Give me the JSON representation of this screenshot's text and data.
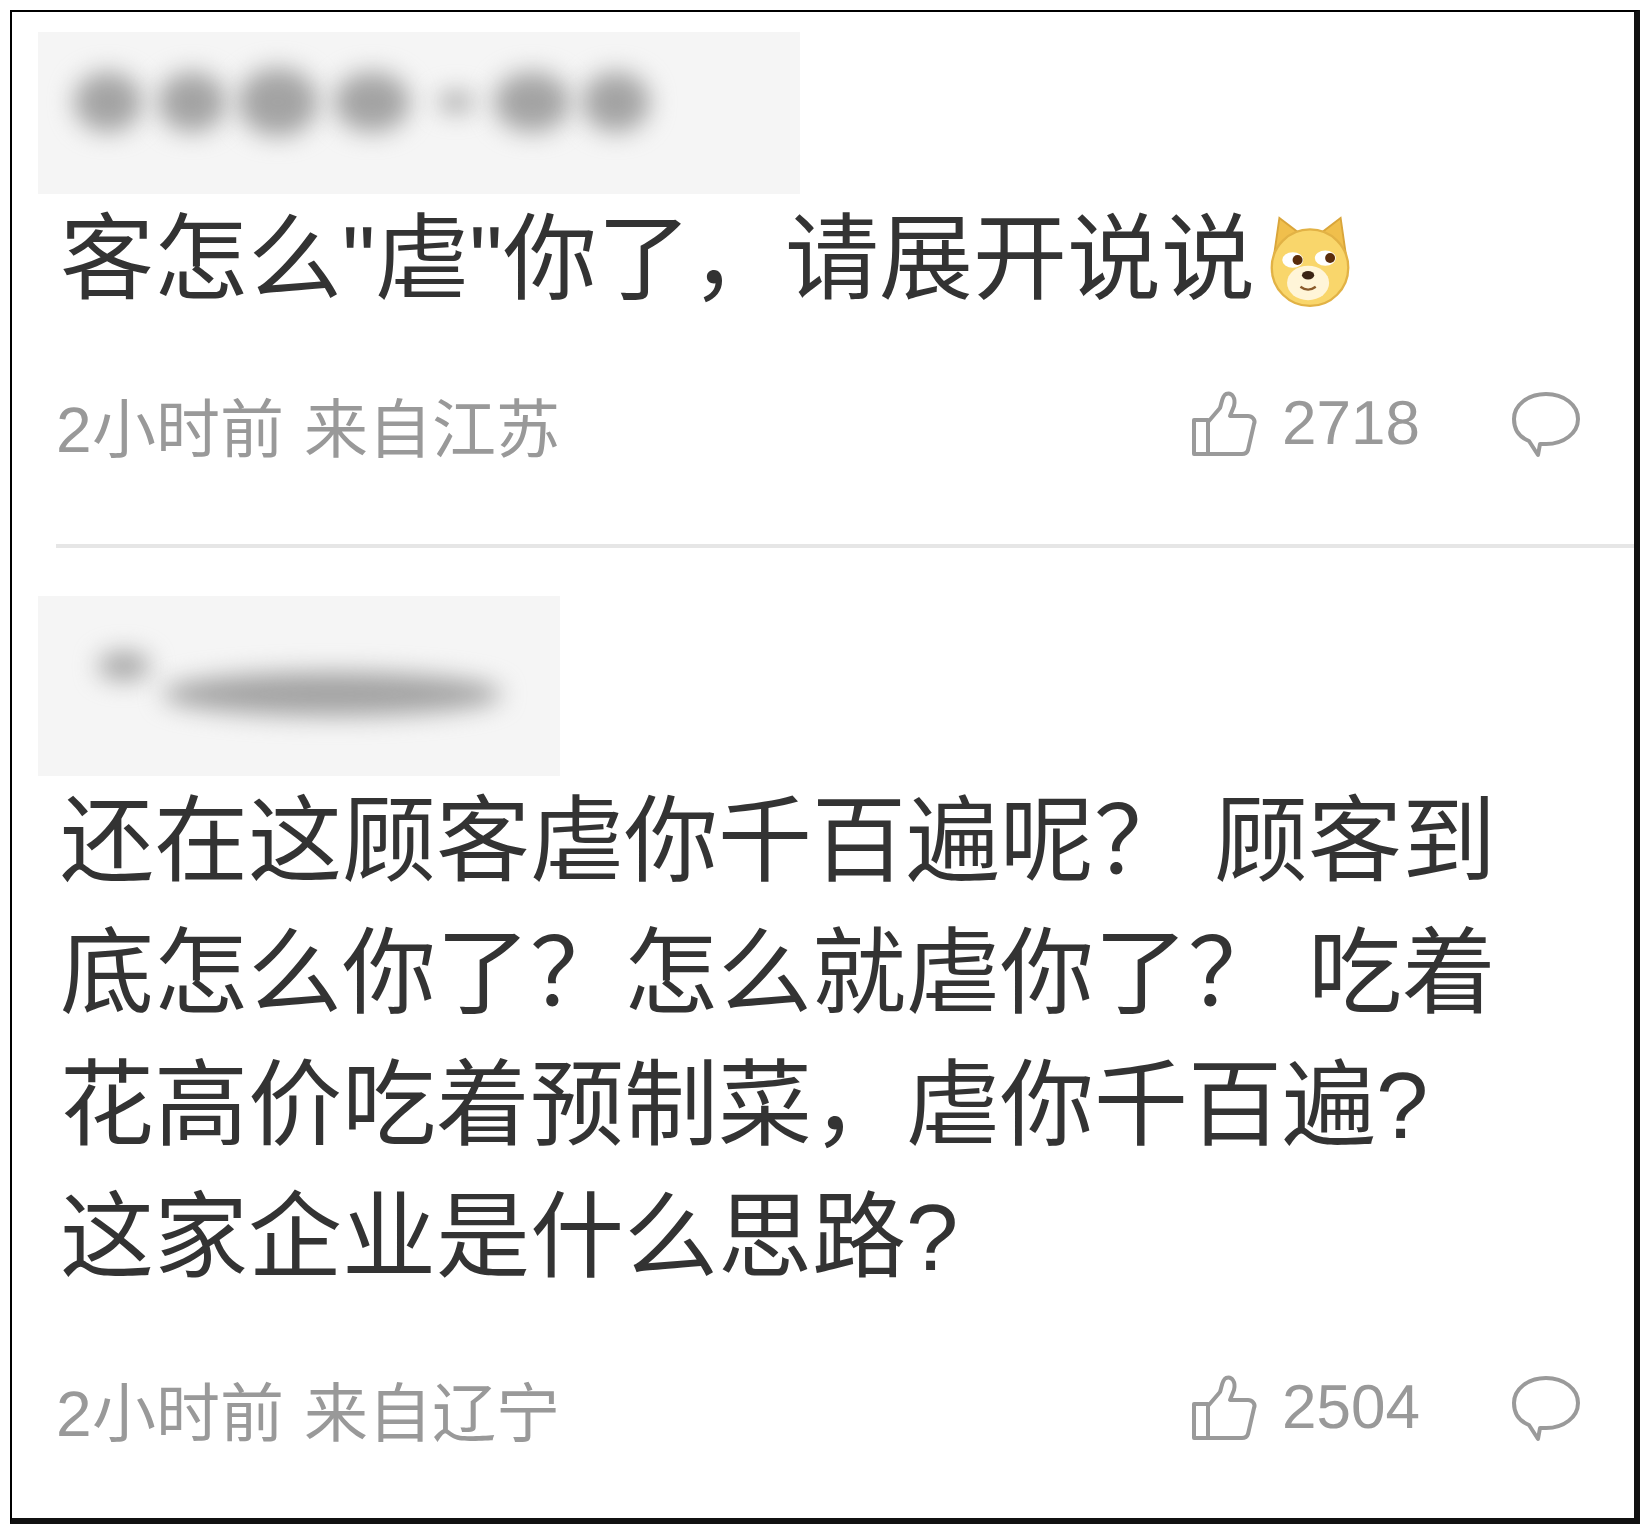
{
  "comments": [
    {
      "text": "客怎么\"虐\"你了，请展开说说",
      "has_emoji": true,
      "time": "2小时前",
      "location": "来自江苏",
      "likes": "2718"
    },
    {
      "text": "还在这顾客虐你千百遍呢？ 顾客到底怎么你了？怎么就虐你了？ 吃着花高价吃着预制菜，虐你千百遍?这家企业是什么思路?",
      "has_emoji": false,
      "time": "2小时前",
      "location": "来自辽宁",
      "likes": "2504"
    }
  ]
}
